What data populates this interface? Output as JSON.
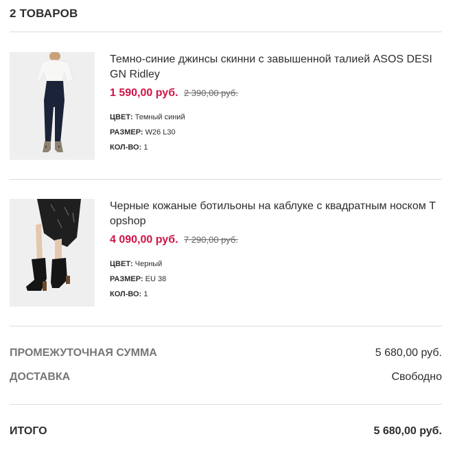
{
  "cart": {
    "count_label": "2 ТОВАРОВ"
  },
  "items": [
    {
      "title": "Темно-синие джинсы скинни с завышенной талией ASOS DESIGN Ridley",
      "price": "1 590,00 руб.",
      "old_price": "2 390,00 руб.",
      "color_label": "ЦВЕТ:",
      "color_value": "Темный синий",
      "size_label": "РАЗМЕР:",
      "size_value": "W26 L30",
      "qty_label": "КОЛ-ВО:",
      "qty_value": "1",
      "image_icon": "jeans-product-photo"
    },
    {
      "title": "Черные кожаные ботильоны на каблуке с квадратным носком Topshop",
      "price": "4 090,00 руб.",
      "old_price": "7 290,00 руб.",
      "color_label": "ЦВЕТ:",
      "color_value": "Черный",
      "size_label": "РАЗМЕР:",
      "size_value": "EU 38",
      "qty_label": "КОЛ-ВО:",
      "qty_value": "1",
      "image_icon": "boots-product-photo"
    }
  ],
  "summary": {
    "subtotal_label": "ПРОМЕЖУТОЧНАЯ СУММА",
    "subtotal_value": "5 680,00 руб.",
    "delivery_label": "ДОСТАВКА",
    "delivery_value": "Свободно",
    "total_label": "ИТОГО",
    "total_value": "5 680,00 руб."
  },
  "colors": {
    "sale_price": "#d01345",
    "text": "#2d2d2d",
    "muted": "#767676",
    "divider": "#dddddd"
  }
}
